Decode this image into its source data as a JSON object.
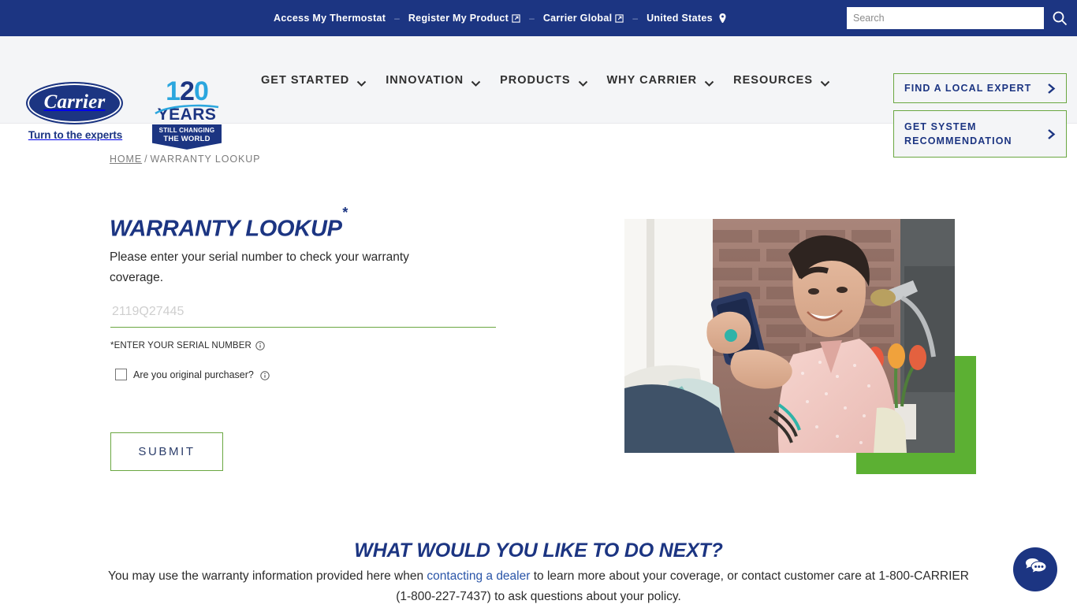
{
  "utility": {
    "links": [
      {
        "label": "Access My Thermostat",
        "icon": null
      },
      {
        "label": "Register My Product",
        "icon": "external-link-icon"
      },
      {
        "label": "Carrier Global",
        "icon": "external-link-icon"
      },
      {
        "label": "United States",
        "icon": "location-pin-icon"
      }
    ],
    "separator": "–",
    "search": {
      "placeholder": "Search",
      "value": "",
      "button_icon": "search-icon"
    }
  },
  "header": {
    "logo": {
      "word": "Carrier",
      "tagline": "Turn to the experts"
    },
    "badge": {
      "num_1": "1",
      "num_2": "2",
      "num_3": "0",
      "years": "YEARS",
      "ribbon_line1": "STILL CHANGING",
      "ribbon_line2": "THE WORLD"
    },
    "nav": [
      {
        "label": "GET STARTED",
        "icon": "chevron-down-icon"
      },
      {
        "label": "INNOVATION",
        "icon": "chevron-down-icon"
      },
      {
        "label": "PRODUCTS",
        "icon": "chevron-down-icon"
      },
      {
        "label": "WHY CARRIER",
        "icon": "chevron-down-icon"
      },
      {
        "label": "RESOURCES",
        "icon": "chevron-down-icon"
      }
    ],
    "cta": {
      "find_expert": "FIND A LOCAL EXPERT",
      "get_recommendation_line1": "GET SYSTEM",
      "get_recommendation_line2": "RECOMMENDATION",
      "icon": "chevron-right-icon"
    }
  },
  "breadcrumb": {
    "home": "HOME",
    "divider": "/",
    "current": "WARRANTY LOOKUP"
  },
  "main": {
    "title": "WARRANTY LOOKUP",
    "title_asterisk": "*",
    "intro": "Please enter your serial number to check your warranty coverage.",
    "serial_field": {
      "placeholder": "2119Q27445",
      "value": "",
      "label": "*ENTER YOUR SERIAL NUMBER",
      "info_icon": "info-circle-icon"
    },
    "checkbox": {
      "label": "Are you original purchaser?",
      "checked": false,
      "info_icon": "info-circle-icon"
    },
    "submit_label": "SUBMIT",
    "hero_image_alt": "woman-with-phone-photo"
  },
  "next_section": {
    "title": "WHAT WOULD YOU LIKE TO DO NEXT?",
    "body_part1": "You may use the warranty information provided here when ",
    "body_link": "contacting a dealer",
    "body_part2": " to learn more about your coverage, or contact customer care at 1-800-CARRIER (1-800-227-7437) to ask questions about your policy."
  },
  "chat": {
    "icon": "chat-bubble-icon"
  },
  "colors": {
    "navy": "#1c3582",
    "green": "#6aa741",
    "green_block": "#5cb033",
    "light_blue": "#2ba6de",
    "link_blue": "#2a55a8",
    "header_bg": "#f4f5f7"
  }
}
